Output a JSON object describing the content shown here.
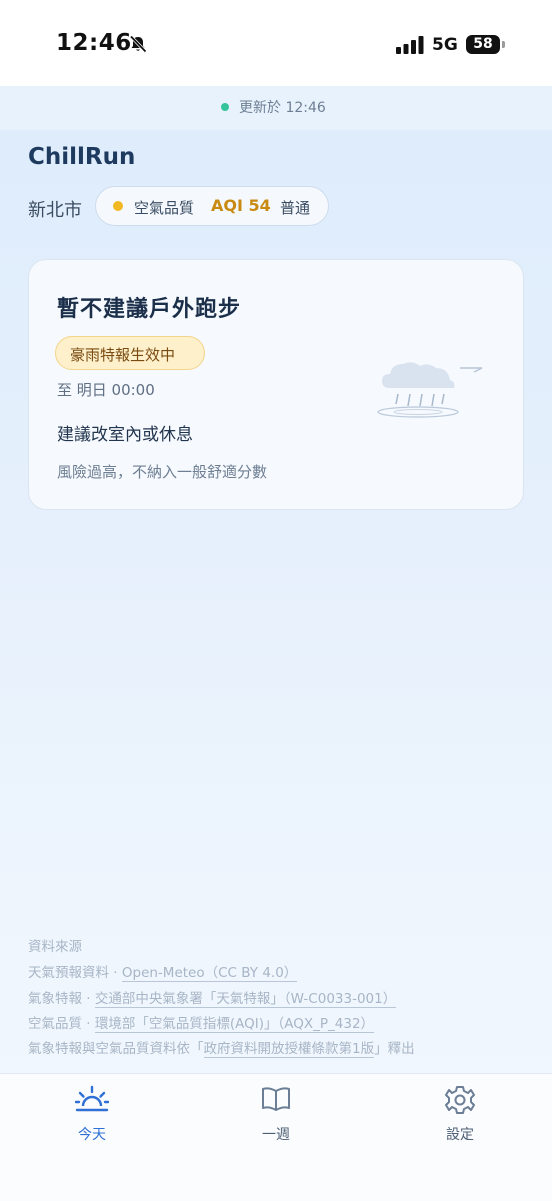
{
  "status_bar": {
    "time": "12:46",
    "network": "5G",
    "battery": "58"
  },
  "update": {
    "text": "更新於 12:46"
  },
  "app": {
    "title": "ChillRun"
  },
  "location": {
    "city": "新北市"
  },
  "aqi": {
    "label": "空氣品質",
    "value": "AQI 54",
    "status": "普通"
  },
  "card": {
    "title": "暫不建議戶外跑步",
    "alert": "豪雨特報生效中",
    "until": "至 明日 00:00",
    "advice": "建議改室內或休息",
    "note": "風險過高，不納入一般舒適分數"
  },
  "sources": {
    "heading": "資料來源",
    "weather_prefix": "天氣預報資料 · ",
    "weather_link": "Open-Meteo（CC BY 4.0）",
    "warn_prefix": "氣象特報 · ",
    "warn_link": "交通部中央氣象署「天氣特報」（W-C0033-001）",
    "air_prefix": "空氣品質 · ",
    "air_link": "環境部「空氣品質指標(AQI)」（AQX_P_432）",
    "license_prefix": "氣象特報與空氣品質資料依「",
    "license_link": "政府資料開放授權條款第1版",
    "license_suffix": "」釋出"
  },
  "tabs": [
    {
      "label": "今天",
      "icon": "sunrise-icon",
      "active": true
    },
    {
      "label": "一週",
      "icon": "book-icon",
      "active": false
    },
    {
      "label": "設定",
      "icon": "gear-icon",
      "active": false
    }
  ],
  "colors": {
    "accent": "#2f6fd6",
    "aqi_moderate": "#f2b824",
    "updated_dot": "#34c39a",
    "alert_bg": "#fdf0cb"
  }
}
